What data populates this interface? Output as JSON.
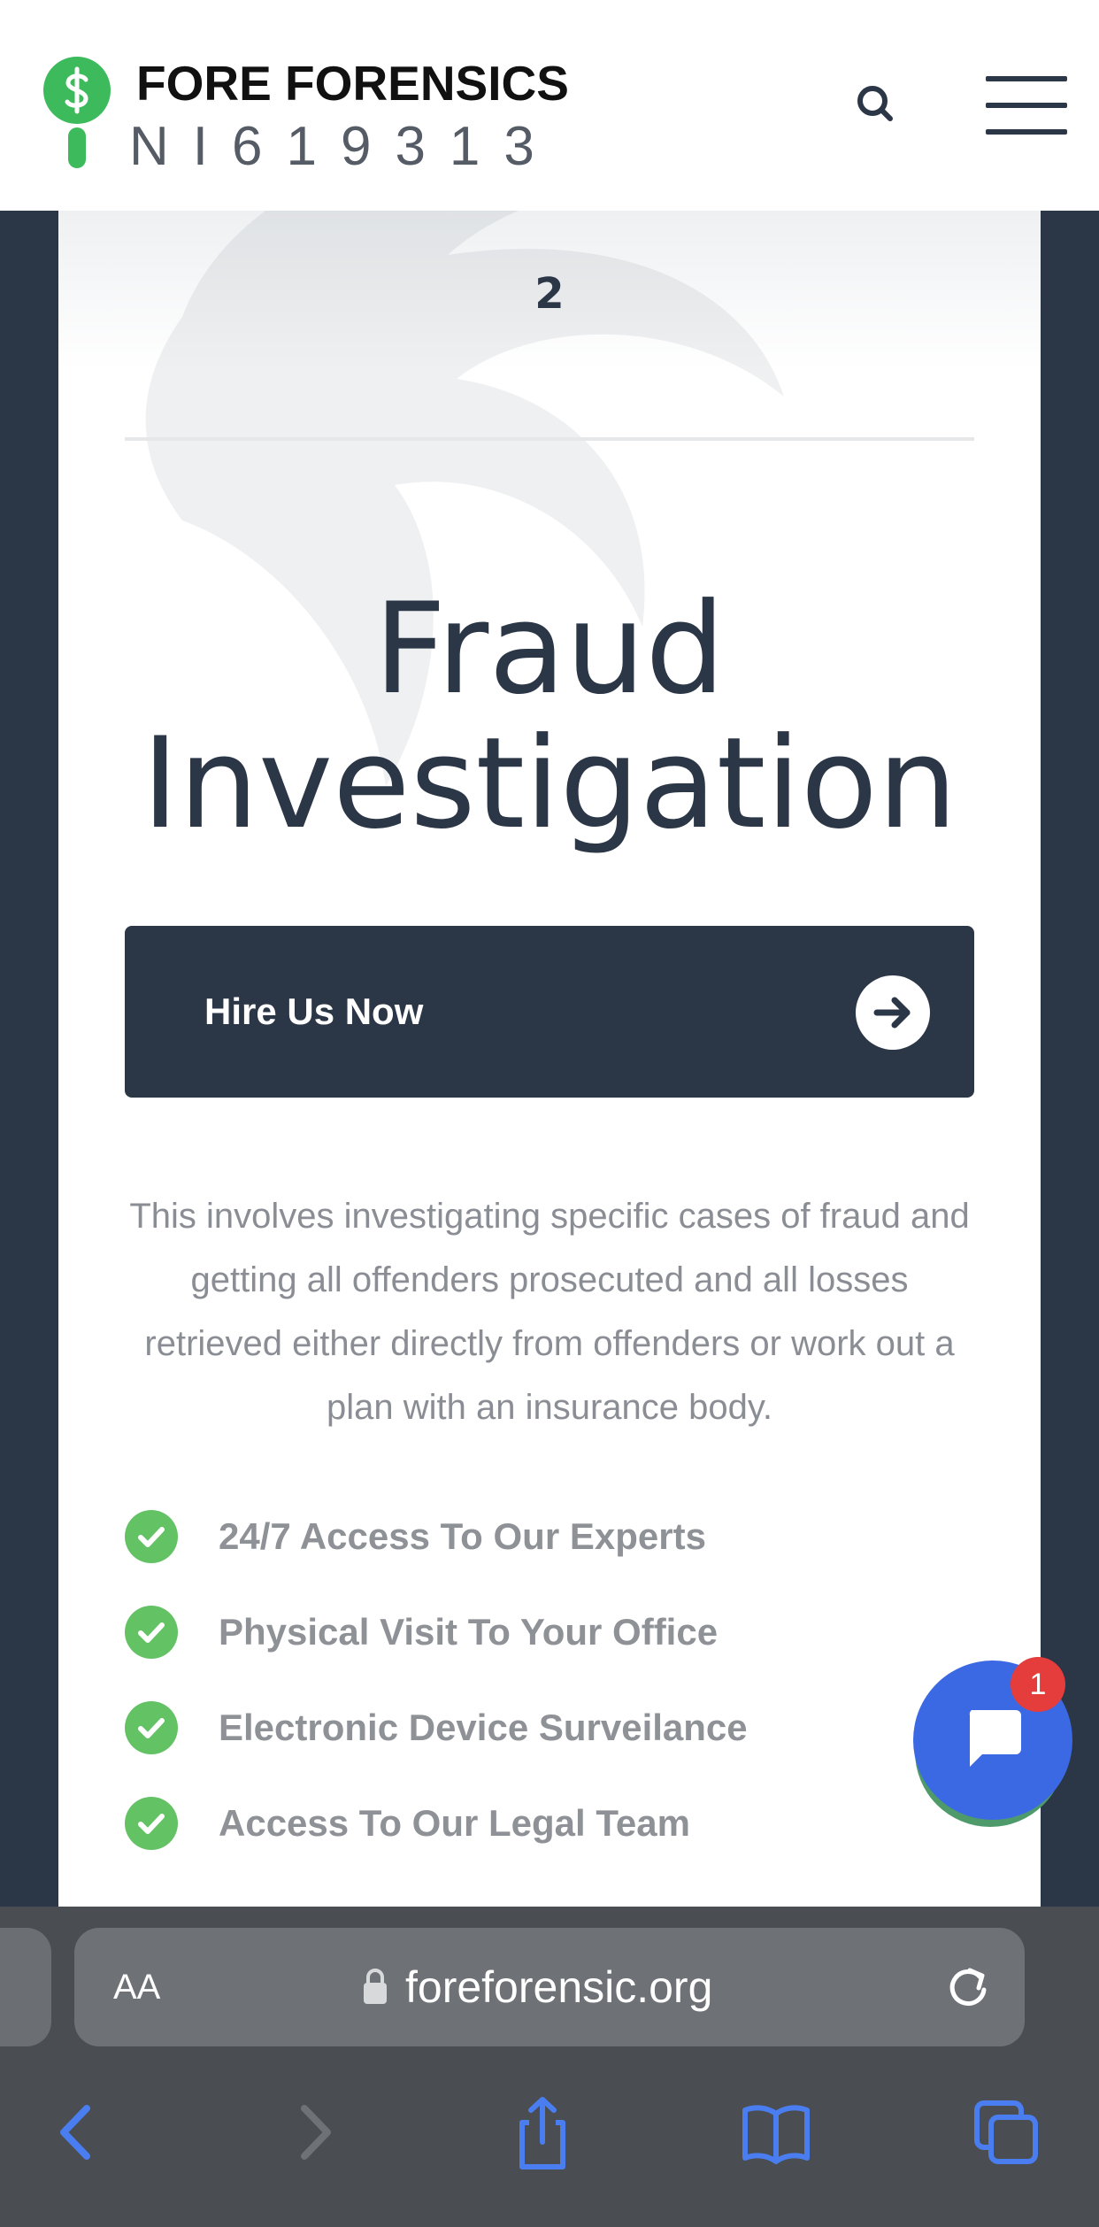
{
  "header": {
    "brand_title": "FORE FORENSICS",
    "brand_subtitle": "NI619313",
    "search_icon": "search-icon",
    "menu_icon": "hamburger-menu-icon"
  },
  "card": {
    "number": "2",
    "title_line1": "Fraud",
    "title_line2": "Investigation",
    "cta_label": "Hire Us Now",
    "cta_icon": "arrow-right-icon",
    "description": "This involves investigating specific cases of fraud and getting all offenders prosecuted and all losses retrieved either directly from offenders or work out a plan with an insurance body.",
    "features": [
      {
        "label": "24/7 Access To Our Experts"
      },
      {
        "label": "Physical Visit To Your Office"
      },
      {
        "label": "Electronic Device Surveilance"
      },
      {
        "label": "Access To Our Legal Team"
      }
    ]
  },
  "chat": {
    "badge_count": "1",
    "icon": "chat-bubble-icon"
  },
  "browser": {
    "text_size_label": "AA",
    "url": "foreforensic.org",
    "toolbar_icons": [
      "back-icon",
      "forward-icon",
      "share-icon",
      "bookmarks-icon",
      "tabs-icon"
    ]
  },
  "colors": {
    "brand_navy": "#2b3646",
    "brand_green": "#62c264",
    "chat_blue": "#3b69e3",
    "badge_red": "#e53c3c",
    "safari_blue": "#4a7ef0"
  }
}
